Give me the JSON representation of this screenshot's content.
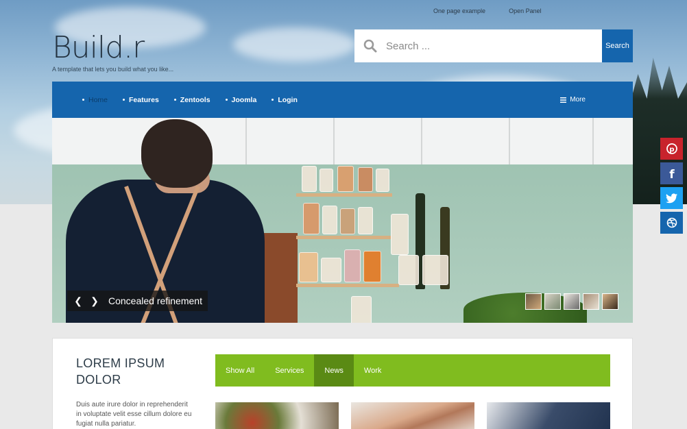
{
  "top_links": [
    "One page example",
    "Open Panel"
  ],
  "logo": "Build.r",
  "tagline": "A template that lets you build what you like...",
  "search": {
    "placeholder": "Search ...",
    "button": "Search"
  },
  "nav": {
    "items": [
      {
        "label": "Home",
        "active": true
      },
      {
        "label": "Features",
        "active": false
      },
      {
        "label": "Zentools",
        "active": false
      },
      {
        "label": "Joomla",
        "active": false
      },
      {
        "label": "Login",
        "active": false
      }
    ],
    "more_label": "More"
  },
  "slider": {
    "caption": "Concealed refinement",
    "prev_icon": "chevron-left-icon",
    "next_icon": "chevron-right-icon",
    "thumbnail_count": 5
  },
  "social": [
    "pinterest-icon",
    "facebook-icon",
    "twitter-icon",
    "dribbble-icon"
  ],
  "section": {
    "title_line1": "LOREM IPSUM",
    "title_line2": "DOLOR",
    "text_line1": "Duis aute irure dolor in reprehenderit",
    "text_line2": "in voluptate velit esse cillum dolore eu",
    "text_line3": "fugiat nulla pariatur."
  },
  "filter": {
    "tabs": [
      {
        "label": "Show All",
        "active": false
      },
      {
        "label": "Services",
        "active": false
      },
      {
        "label": "News",
        "active": true
      },
      {
        "label": "Work",
        "active": false
      }
    ]
  },
  "colors": {
    "primary_blue": "#1565ad",
    "filter_green": "#80bc1f",
    "filter_active": "#5a8a14",
    "pinterest": "#c8232c",
    "facebook": "#3b5998",
    "twitter": "#1da1f2",
    "dribbble": "#1565ad"
  }
}
